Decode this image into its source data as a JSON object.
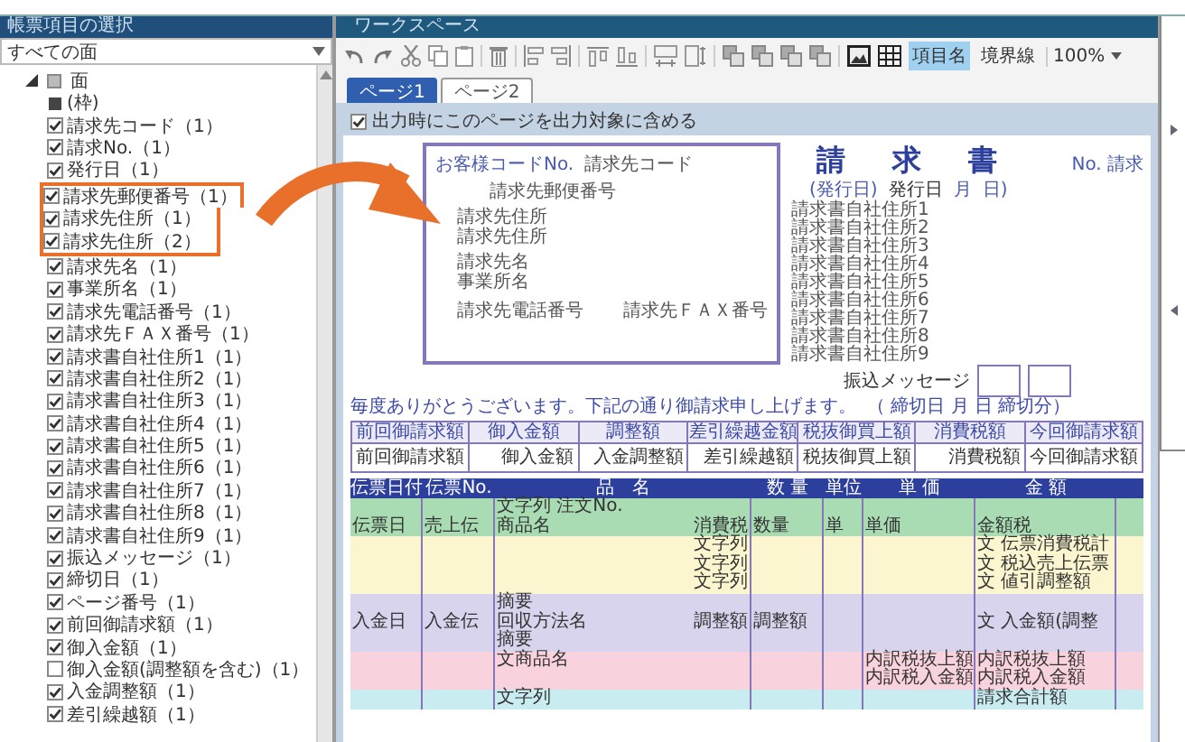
{
  "left_panel": {
    "title": "帳票項目の選択",
    "filter": "すべての面",
    "tree": [
      {
        "label": "面",
        "expanded": true,
        "children": [
          {
            "kind": "frame",
            "label": "(枠)"
          },
          {
            "kind": "checkbox",
            "label": "請求先コード（1）",
            "checked": true,
            "highlighted": false
          },
          {
            "kind": "checkbox",
            "label": "請求No.（1）",
            "checked": true,
            "highlighted": false
          },
          {
            "kind": "checkbox",
            "label": "発行日（1）",
            "checked": true,
            "highlighted": false
          },
          {
            "kind": "checkbox",
            "label": "請求先郵便番号（1）",
            "checked": true,
            "highlighted": true
          },
          {
            "kind": "checkbox",
            "label": "請求先住所（1）",
            "checked": true,
            "highlighted": true
          },
          {
            "kind": "checkbox",
            "label": "請求先住所（2）",
            "checked": true,
            "highlighted": true
          },
          {
            "kind": "checkbox",
            "label": "請求先名（1）",
            "checked": true,
            "highlighted": false
          },
          {
            "kind": "checkbox",
            "label": "事業所名（1）",
            "checked": true,
            "highlighted": false
          },
          {
            "kind": "checkbox",
            "label": "請求先電話番号（1）",
            "checked": true,
            "highlighted": false
          },
          {
            "kind": "checkbox",
            "label": "請求先ＦＡＸ番号（1）",
            "checked": true,
            "highlighted": false
          },
          {
            "kind": "checkbox",
            "label": "請求書自社住所1（1）",
            "checked": true,
            "highlighted": false
          },
          {
            "kind": "checkbox",
            "label": "請求書自社住所2（1）",
            "checked": true,
            "highlighted": false
          },
          {
            "kind": "checkbox",
            "label": "請求書自社住所3（1）",
            "checked": true,
            "highlighted": false
          },
          {
            "kind": "checkbox",
            "label": "請求書自社住所4（1）",
            "checked": true,
            "highlighted": false
          },
          {
            "kind": "checkbox",
            "label": "請求書自社住所5（1）",
            "checked": true,
            "highlighted": false
          },
          {
            "kind": "checkbox",
            "label": "請求書自社住所6（1）",
            "checked": true,
            "highlighted": false
          },
          {
            "kind": "checkbox",
            "label": "請求書自社住所7（1）",
            "checked": true,
            "highlighted": false
          },
          {
            "kind": "checkbox",
            "label": "請求書自社住所8（1）",
            "checked": true,
            "highlighted": false
          },
          {
            "kind": "checkbox",
            "label": "請求書自社住所9（1）",
            "checked": true,
            "highlighted": false
          },
          {
            "kind": "checkbox",
            "label": "振込メッセージ（1）",
            "checked": true,
            "highlighted": false
          },
          {
            "kind": "checkbox",
            "label": "締切日（1）",
            "checked": true,
            "highlighted": false
          },
          {
            "kind": "checkbox",
            "label": "ページ番号（1）",
            "checked": true,
            "highlighted": false
          },
          {
            "kind": "checkbox",
            "label": "前回御請求額（1）",
            "checked": true,
            "highlighted": false
          },
          {
            "kind": "checkbox",
            "label": "御入金額（1）",
            "checked": true,
            "highlighted": false
          },
          {
            "kind": "checkbox",
            "label": "御入金額(調整額を含む)（1）",
            "checked": false,
            "highlighted": false
          },
          {
            "kind": "checkbox",
            "label": "入金調整額（1）",
            "checked": true,
            "highlighted": false
          },
          {
            "kind": "checkbox",
            "label": "差引繰越額（1）",
            "checked": true,
            "highlighted": false
          }
        ]
      }
    ]
  },
  "workspace": {
    "title": "ワークスペース",
    "toggles": [
      {
        "label": "項目名",
        "selected": true
      },
      {
        "label": "境界線",
        "selected": false
      }
    ],
    "zoom": "100%",
    "tabs": [
      {
        "label": "ページ1",
        "selected": true
      },
      {
        "label": "ページ2",
        "selected": false
      }
    ],
    "include_option": {
      "label": "出力時にこのページを出力対象に含める",
      "checked": true
    },
    "form": {
      "address_box": {
        "code_label": "お客様コードNo.",
        "code": "請求先コード",
        "groups": [
          [
            "請求先郵便番号"
          ],
          [
            "請求先住所",
            "請求先住所"
          ],
          [
            "請求先名",
            "事業所名"
          ]
        ],
        "phone": "請求先電話番号",
        "fax": "請求先ＦＡＸ番号"
      },
      "title": "請　求　書",
      "number": "No. 請求",
      "issue_label": "(発行日)",
      "issue_date": "発行日",
      "month": "月",
      "day": "日)",
      "company_lines": [
        "請求書自社住所1",
        "請求書自社住所2",
        "請求書自社住所3",
        "請求書自社住所4",
        "請求書自社住所5",
        "請求書自社住所6",
        "請求書自社住所7",
        "請求書自社住所8",
        "請求書自社住所9"
      ],
      "message": "振込メッセージ",
      "greeting": "毎度ありがとうございます。下記の通り御請求申し上げます。",
      "closing": "（ 締切日 月 日 締切分）",
      "summary": [
        {
          "heading": "前回御請求額",
          "value": "前回御請求額"
        },
        {
          "heading": "御入金額",
          "value": "御入金額"
        },
        {
          "heading": "調整額",
          "value": "入金調整額"
        },
        {
          "heading": "差引繰越金額",
          "value": "差引繰越額"
        },
        {
          "heading": "税抜御買上額",
          "value": "税抜御買上額"
        },
        {
          "heading": "消費税額",
          "value": "消費税額"
        },
        {
          "heading": "今回御請求額",
          "value": "今回御請求額"
        }
      ],
      "detail_columns": [
        "伝票日付",
        "伝票No.",
        "品　名",
        "数 量",
        "単位",
        "単 価",
        "金 額"
      ],
      "bands": [
        {
          "kind": "item",
          "color": "#a9dcb3",
          "lines": [
            {
              "name": [
                "文字列 注文No."
              ]
            },
            {
              "date": [
                "伝票日"
              ],
              "no": [
                "売上伝"
              ],
              "name": [
                "商品名",
                "消費税"
              ],
              "qty": [
                "数量"
              ],
              "unit": [
                "単"
              ],
              "price": [
                "単価"
              ],
              "amount": [
                "金額税"
              ]
            }
          ]
        },
        {
          "kind": "tax",
          "color": "#fbf6cf",
          "lines": [
            {
              "name": [
                "文字列"
              ],
              "amount": [
                "文 伝票消費税計"
              ]
            },
            {
              "name": [
                "文字列"
              ],
              "amount": [
                "文 税込売上伝票"
              ]
            },
            {
              "name": [
                "文字列"
              ],
              "amount": [
                "文 値引調整額"
              ]
            }
          ]
        },
        {
          "kind": "payment",
          "color": "#d9d4ee",
          "lines": [
            {
              "name": [
                "摘要"
              ]
            },
            {
              "date": [
                "入金日"
              ],
              "no": [
                "入金伝"
              ],
              "name": [
                "回収方法名",
                "調整額"
              ],
              "qty": [
                "調整額"
              ],
              "amount": [
                "文 入金額(調整"
              ]
            },
            {
              "name": [
                "摘要"
              ]
            }
          ]
        },
        {
          "kind": "breakdown",
          "color": "#f8d2dc",
          "lines": [
            {
              "name": [
                "文商品名"
              ],
              "price": [
                "内訳税抜上額"
              ],
              "amount": [
                "内訳税抜上額"
              ]
            },
            {
              "price": [
                "内訳税入金額"
              ],
              "amount": [
                "内訳税入金額"
              ]
            }
          ]
        },
        {
          "kind": "total",
          "color": "#c8ecf0",
          "lines": [
            {
              "name": [
                "文字列"
              ],
              "amount": [
                "請求合計額"
              ]
            }
          ]
        }
      ]
    }
  }
}
